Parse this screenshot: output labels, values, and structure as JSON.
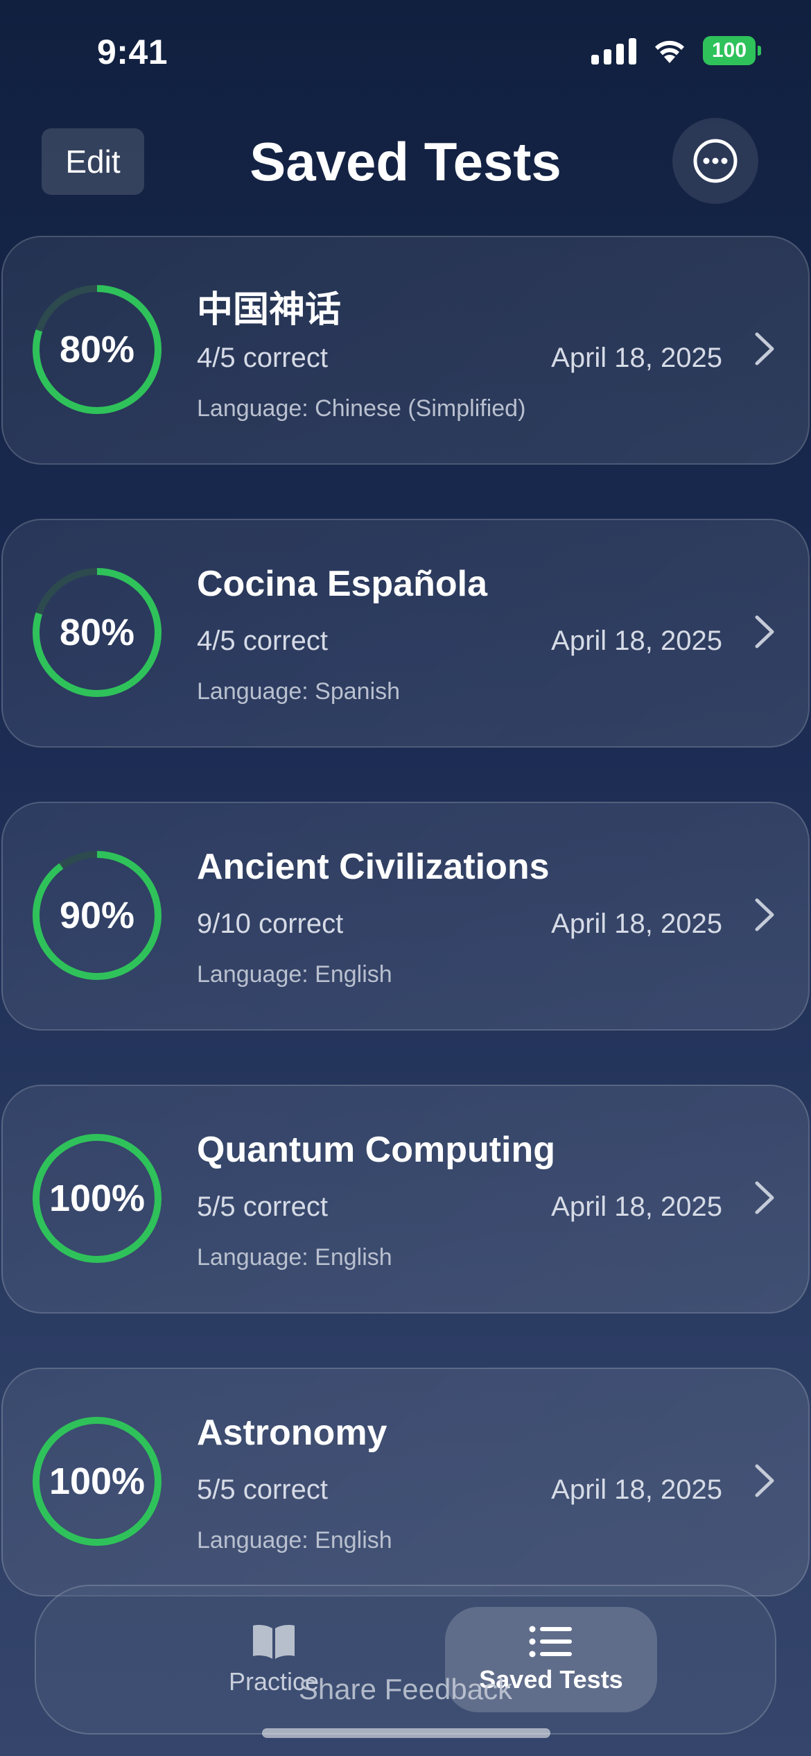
{
  "status_bar": {
    "time": "9:41",
    "battery": "100"
  },
  "header": {
    "edit_label": "Edit",
    "title": "Saved Tests",
    "more_icon": "ellipsis-circle-icon"
  },
  "colors": {
    "accent_green": "#2fc25b",
    "ring_track": "#2d4a4f"
  },
  "tests": [
    {
      "title": "中国神话",
      "score_percent": 80,
      "percent_label": "80%",
      "correct": "4/5 correct",
      "date": "April 18, 2025",
      "language": "Language: Chinese (Simplified)"
    },
    {
      "title": "Cocina Española",
      "score_percent": 80,
      "percent_label": "80%",
      "correct": "4/5 correct",
      "date": "April 18, 2025",
      "language": "Language: Spanish"
    },
    {
      "title": "Ancient Civilizations",
      "score_percent": 90,
      "percent_label": "90%",
      "correct": "9/10 correct",
      "date": "April 18, 2025",
      "language": "Language: English"
    },
    {
      "title": "Quantum Computing",
      "score_percent": 100,
      "percent_label": "100%",
      "correct": "5/5 correct",
      "date": "April 18, 2025",
      "language": "Language: English"
    },
    {
      "title": "Astronomy",
      "score_percent": 100,
      "percent_label": "100%",
      "correct": "5/5 correct",
      "date": "April 18, 2025",
      "language": "Language: English"
    }
  ],
  "tab_bar": {
    "practice_label": "Practice",
    "practice_icon": "book-icon",
    "saved_label": "Saved Tests",
    "saved_icon": "list-icon",
    "share_feedback": "Share Feedback"
  }
}
